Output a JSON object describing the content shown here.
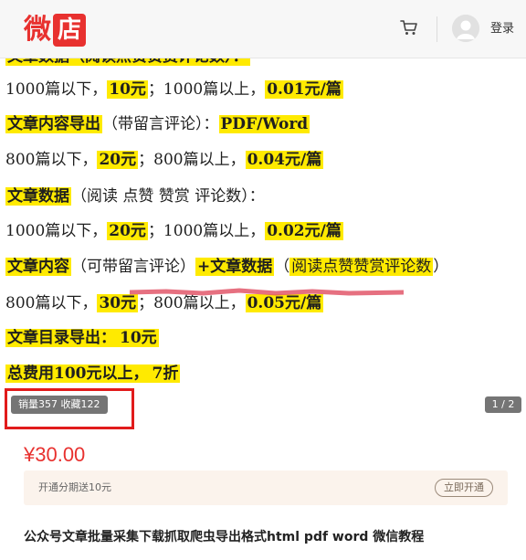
{
  "header": {
    "logo_char1": "微",
    "logo_char2": "店",
    "login_label": "登录",
    "icons": [
      "cart-icon",
      "avatar-icon"
    ],
    "brand_color": "#e8312f"
  },
  "content": {
    "partial_line": "文章数据（阅读点赞赞赏评论数）：",
    "line1": {
      "a": "1000篇以下，",
      "b": "10元",
      "c": "；1000篇以上，",
      "d": "0.01元/篇"
    },
    "line2": {
      "a": "文章内容导出",
      "b": "（带留言评论）：",
      "c": "PDF/Word"
    },
    "line3": {
      "a": "800篇以下，",
      "b": "20元",
      "c": "；800篇以上，",
      "d": "0.04元/篇"
    },
    "line4": {
      "a": "文章数据",
      "b": "（阅读 点赞 赞赏 评论数）："
    },
    "line5": {
      "a": "1000篇以下，",
      "b": "20元",
      "c": "；1000篇以上，",
      "d": "0.02元/篇"
    },
    "line6": {
      "a": "文章内容",
      "b": "（可带留言评论）",
      "c": "+文章数据",
      "d": "（",
      "e": "阅读点赞赞赏评论数",
      "f": "）"
    },
    "line7": {
      "a": "800篇以下，",
      "b": "30元",
      "c": "；800篇以上，",
      "d": "0.05元/篇"
    },
    "line8": {
      "a": "文章目录导出：",
      "b": "10元"
    },
    "line9": {
      "a": "总费用100元以上，",
      "b": "7折"
    },
    "highlight_color": "#ffea00"
  },
  "badge": {
    "sales": "销量357 收藏122",
    "pager": "1 / 2"
  },
  "price": "¥30.00",
  "promo": {
    "text": "开通分期送10元",
    "button": "立即开通"
  },
  "title": "公众号文章批量采集下载抓取爬虫导出格式html pdf word 微信教程"
}
